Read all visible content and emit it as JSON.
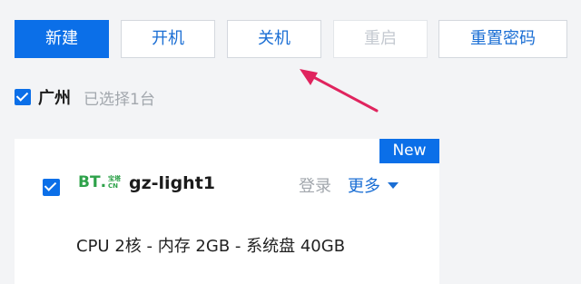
{
  "toolbar": {
    "new_label": "新建",
    "start_label": "开机",
    "stop_label": "关机",
    "restart_label": "重启",
    "reset_password_label": "重置密码"
  },
  "region": {
    "name": "广州",
    "selected_text": "已选择1台"
  },
  "server": {
    "badge": "New",
    "logo_text": "BT",
    "logo_sub_top": "宝塔",
    "logo_sub_bottom": "CN",
    "name": "gz-light1",
    "login_label": "登录",
    "more_label": "更多",
    "specs": "CPU 2核 - 内存 2GB - 系统盘 40GB"
  },
  "colors": {
    "accent": "#0b6fe8",
    "annotation_arrow": "#e0245e",
    "logo_green": "#2ea24a"
  }
}
